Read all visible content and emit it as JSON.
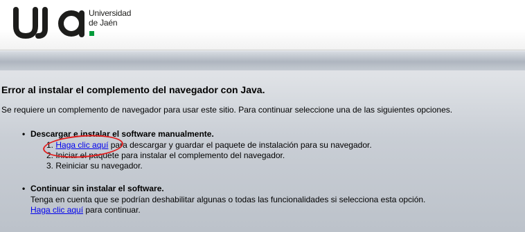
{
  "header": {
    "logo_mark": "uja",
    "logo_line1": "Universidad",
    "logo_line2": "de Jaén",
    "colors": {
      "logo_dark": "#1d1d1b",
      "logo_green": "#009b3a"
    }
  },
  "main": {
    "title": "Error al instalar el complemento del navegador con Java.",
    "intro": "Se requiere un complemento de navegador para usar este sitio. Para continuar seleccione una de las siguientes opciones.",
    "option1": {
      "heading": "Descargar e instalar el software manualmente.",
      "step1_num": "1.",
      "step1_link": "Haga clic aquí",
      "step1_text": " para descargar y guardar el paquete de instalación para su navegador.",
      "step2": "2. Iniciar el paquete para instalar el complemento del navegador.",
      "step3": "3. Reiniciar su navegador."
    },
    "option2": {
      "heading": "Continuar sin instalar el software.",
      "note": "Tenga en cuenta que se podrían deshabilitar algunas o todas las funcionalidades si selecciona esta opción.",
      "link": "Haga clic aquí",
      "link_suffix": " para continuar."
    },
    "colors": {
      "link": "#0000ee",
      "highlight_circle": "#e01f1f"
    }
  }
}
